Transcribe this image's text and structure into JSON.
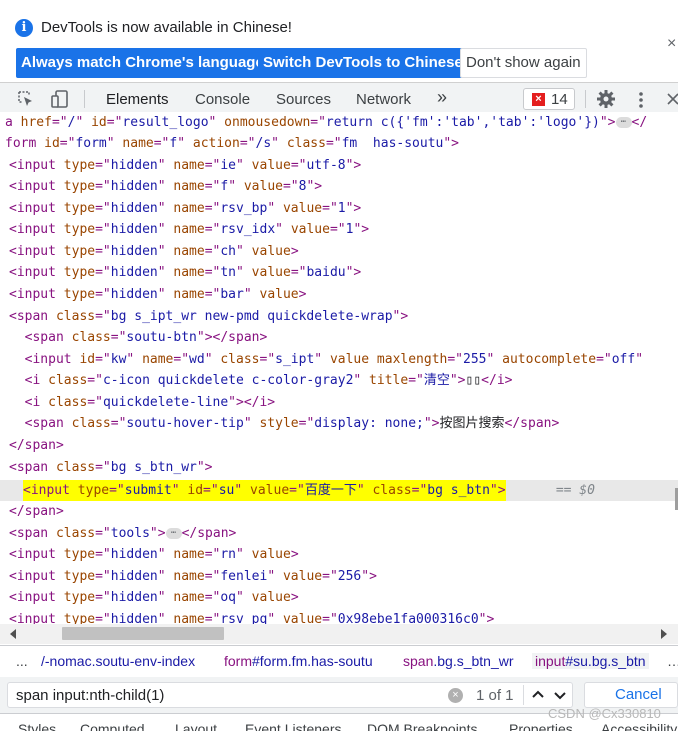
{
  "infobar": {
    "message": "DevTools is now available in Chinese!",
    "info_icon": "info-icon",
    "buttons": {
      "always_match": "Always match Chrome's language",
      "switch": "Switch DevTools to Chinese",
      "dont_show": "Don't show again"
    },
    "close": "×"
  },
  "toolbar": {
    "tabs": [
      "Elements",
      "Console",
      "Sources",
      "Network"
    ],
    "more": "»",
    "error_count": "14",
    "icons": [
      "inspect-element-icon",
      "device-toolbar-icon",
      "settings-gear-icon",
      "more-vertical-icon",
      "close-icon"
    ]
  },
  "code": {
    "lines": [
      [
        [
          "tg",
          "a "
        ],
        [
          "an",
          "href"
        ],
        [
          "tg",
          "=\""
        ],
        [
          "av",
          "/"
        ],
        [
          "tg",
          "\" "
        ],
        [
          "an",
          "id"
        ],
        [
          "tg",
          "=\""
        ],
        [
          "av",
          "result_logo"
        ],
        [
          "tg",
          "\" "
        ],
        [
          "an",
          "onmousedown"
        ],
        [
          "tg",
          "=\""
        ],
        [
          "av",
          "return c({'fm':'tab','tab':'logo'})"
        ],
        [
          "tg",
          "\">"
        ],
        [
          "ell",
          "⋯"
        ],
        [
          "tg",
          "</"
        ]
      ],
      [
        [
          "tg",
          "form "
        ],
        [
          "an",
          "id"
        ],
        [
          "tg",
          "=\""
        ],
        [
          "av",
          "form"
        ],
        [
          "tg",
          "\" "
        ],
        [
          "an",
          "name"
        ],
        [
          "tg",
          "=\""
        ],
        [
          "av",
          "f"
        ],
        [
          "tg",
          "\" "
        ],
        [
          "an",
          "action"
        ],
        [
          "tg",
          "=\""
        ],
        [
          "av",
          "/s"
        ],
        [
          "tg",
          "\" "
        ],
        [
          "an",
          "class"
        ],
        [
          "tg",
          "=\""
        ],
        [
          "av",
          "fm  has-soutu"
        ],
        [
          "tg",
          "\">"
        ]
      ],
      [
        [
          "tg",
          "<input "
        ],
        [
          "an",
          "type"
        ],
        [
          "tg",
          "=\""
        ],
        [
          "av",
          "hidden"
        ],
        [
          "tg",
          "\" "
        ],
        [
          "an",
          "name"
        ],
        [
          "tg",
          "=\""
        ],
        [
          "av",
          "ie"
        ],
        [
          "tg",
          "\" "
        ],
        [
          "an",
          "value"
        ],
        [
          "tg",
          "=\""
        ],
        [
          "av",
          "utf-8"
        ],
        [
          "tg",
          "\">"
        ]
      ],
      [
        [
          "tg",
          "<input "
        ],
        [
          "an",
          "type"
        ],
        [
          "tg",
          "=\""
        ],
        [
          "av",
          "hidden"
        ],
        [
          "tg",
          "\" "
        ],
        [
          "an",
          "name"
        ],
        [
          "tg",
          "=\""
        ],
        [
          "av",
          "f"
        ],
        [
          "tg",
          "\" "
        ],
        [
          "an",
          "value"
        ],
        [
          "tg",
          "=\""
        ],
        [
          "av",
          "8"
        ],
        [
          "tg",
          "\">"
        ]
      ],
      [
        [
          "tg",
          "<input "
        ],
        [
          "an",
          "type"
        ],
        [
          "tg",
          "=\""
        ],
        [
          "av",
          "hidden"
        ],
        [
          "tg",
          "\" "
        ],
        [
          "an",
          "name"
        ],
        [
          "tg",
          "=\""
        ],
        [
          "av",
          "rsv_bp"
        ],
        [
          "tg",
          "\" "
        ],
        [
          "an",
          "value"
        ],
        [
          "tg",
          "=\""
        ],
        [
          "av",
          "1"
        ],
        [
          "tg",
          "\">"
        ]
      ],
      [
        [
          "tg",
          "<input "
        ],
        [
          "an",
          "type"
        ],
        [
          "tg",
          "=\""
        ],
        [
          "av",
          "hidden"
        ],
        [
          "tg",
          "\" "
        ],
        [
          "an",
          "name"
        ],
        [
          "tg",
          "=\""
        ],
        [
          "av",
          "rsv_idx"
        ],
        [
          "tg",
          "\" "
        ],
        [
          "an",
          "value"
        ],
        [
          "tg",
          "=\""
        ],
        [
          "av",
          "1"
        ],
        [
          "tg",
          "\">"
        ]
      ],
      [
        [
          "tg",
          "<input "
        ],
        [
          "an",
          "type"
        ],
        [
          "tg",
          "=\""
        ],
        [
          "av",
          "hidden"
        ],
        [
          "tg",
          "\" "
        ],
        [
          "an",
          "name"
        ],
        [
          "tg",
          "=\""
        ],
        [
          "av",
          "ch"
        ],
        [
          "tg",
          "\" "
        ],
        [
          "an",
          "value"
        ],
        [
          "tg",
          ">"
        ]
      ],
      [
        [
          "tg",
          "<input "
        ],
        [
          "an",
          "type"
        ],
        [
          "tg",
          "=\""
        ],
        [
          "av",
          "hidden"
        ],
        [
          "tg",
          "\" "
        ],
        [
          "an",
          "name"
        ],
        [
          "tg",
          "=\""
        ],
        [
          "av",
          "tn"
        ],
        [
          "tg",
          "\" "
        ],
        [
          "an",
          "value"
        ],
        [
          "tg",
          "=\""
        ],
        [
          "av",
          "baidu"
        ],
        [
          "tg",
          "\">"
        ]
      ],
      [
        [
          "tg",
          "<input "
        ],
        [
          "an",
          "type"
        ],
        [
          "tg",
          "=\""
        ],
        [
          "av",
          "hidden"
        ],
        [
          "tg",
          "\" "
        ],
        [
          "an",
          "name"
        ],
        [
          "tg",
          "=\""
        ],
        [
          "av",
          "bar"
        ],
        [
          "tg",
          "\" "
        ],
        [
          "an",
          "value"
        ],
        [
          "tg",
          ">"
        ]
      ],
      [
        [
          "tg",
          "<span "
        ],
        [
          "an",
          "class"
        ],
        [
          "tg",
          "=\""
        ],
        [
          "av",
          "bg s_ipt_wr new-pmd quickdelete-wrap"
        ],
        [
          "tg",
          "\">"
        ]
      ],
      [
        [
          "tg",
          "  <span "
        ],
        [
          "an",
          "class"
        ],
        [
          "tg",
          "=\""
        ],
        [
          "av",
          "soutu-btn"
        ],
        [
          "tg",
          "\"></span>"
        ]
      ],
      [
        [
          "tg",
          "  <input "
        ],
        [
          "an",
          "id"
        ],
        [
          "tg",
          "=\""
        ],
        [
          "av",
          "kw"
        ],
        [
          "tg",
          "\" "
        ],
        [
          "an",
          "name"
        ],
        [
          "tg",
          "=\""
        ],
        [
          "av",
          "wd"
        ],
        [
          "tg",
          "\" "
        ],
        [
          "an",
          "class"
        ],
        [
          "tg",
          "=\""
        ],
        [
          "av",
          "s_ipt"
        ],
        [
          "tg",
          "\" "
        ],
        [
          "an",
          "value maxlength"
        ],
        [
          "tg",
          "=\""
        ],
        [
          "av",
          "255"
        ],
        [
          "tg",
          "\" "
        ],
        [
          "an",
          "autocomplete"
        ],
        [
          "tg",
          "=\""
        ],
        [
          "av",
          "off"
        ],
        [
          "tg",
          "\""
        ]
      ],
      [
        [
          "tg",
          "  <i "
        ],
        [
          "an",
          "class"
        ],
        [
          "tg",
          "=\""
        ],
        [
          "av",
          "c-icon quickdelete c-color-gray2"
        ],
        [
          "tg",
          "\" "
        ],
        [
          "an",
          "title"
        ],
        [
          "tg",
          "=\""
        ],
        [
          "av",
          "清空"
        ],
        [
          "tg",
          "\">"
        ],
        [
          "tx",
          "▯▯"
        ],
        [
          "tg",
          "</i>"
        ]
      ],
      [
        [
          "tg",
          "  <i "
        ],
        [
          "an",
          "class"
        ],
        [
          "tg",
          "=\""
        ],
        [
          "av",
          "quickdelete-line"
        ],
        [
          "tg",
          "\"></i>"
        ]
      ],
      [
        [
          "tg",
          "  <span "
        ],
        [
          "an",
          "class"
        ],
        [
          "tg",
          "=\""
        ],
        [
          "av",
          "soutu-hover-tip"
        ],
        [
          "tg",
          "\" "
        ],
        [
          "an",
          "style"
        ],
        [
          "tg",
          "=\""
        ],
        [
          "av",
          "display: none;"
        ],
        [
          "tg",
          "\">"
        ],
        [
          "tx",
          "按图片搜索"
        ],
        [
          "tg",
          "</span>"
        ]
      ],
      [
        [
          "tg",
          "</span>"
        ]
      ],
      [
        [
          "tg",
          "<span "
        ],
        [
          "an",
          "class"
        ],
        [
          "tg",
          "=\""
        ],
        [
          "av",
          "bg s_btn_wr"
        ],
        [
          "tg",
          "\">"
        ]
      ],
      [
        [
          "tg",
          "<input "
        ],
        [
          "an",
          "type"
        ],
        [
          "tg",
          "=\""
        ],
        [
          "av",
          "submit"
        ],
        [
          "tg",
          "\" "
        ],
        [
          "an",
          "id"
        ],
        [
          "tg",
          "=\""
        ],
        [
          "av",
          "su"
        ],
        [
          "tg",
          "\" "
        ],
        [
          "an",
          "value"
        ],
        [
          "tg",
          "=\""
        ],
        [
          "av",
          "百度一下"
        ],
        [
          "tg",
          "\" "
        ],
        [
          "an",
          "class"
        ],
        [
          "tg",
          "=\""
        ],
        [
          "av",
          "bg s_btn"
        ],
        [
          "tg",
          "\">"
        ]
      ],
      [
        [
          "tg",
          "</span>"
        ]
      ],
      [
        [
          "tg",
          "<span "
        ],
        [
          "an",
          "class"
        ],
        [
          "tg",
          "=\""
        ],
        [
          "av",
          "tools"
        ],
        [
          "tg",
          "\">"
        ],
        [
          "ell",
          "⋯"
        ],
        [
          "tg",
          "</span>"
        ]
      ],
      [
        [
          "tg",
          "<input "
        ],
        [
          "an",
          "type"
        ],
        [
          "tg",
          "=\""
        ],
        [
          "av",
          "hidden"
        ],
        [
          "tg",
          "\" "
        ],
        [
          "an",
          "name"
        ],
        [
          "tg",
          "=\""
        ],
        [
          "av",
          "rn"
        ],
        [
          "tg",
          "\" "
        ],
        [
          "an",
          "value"
        ],
        [
          "tg",
          ">"
        ]
      ],
      [
        [
          "tg",
          "<input "
        ],
        [
          "an",
          "type"
        ],
        [
          "tg",
          "=\""
        ],
        [
          "av",
          "hidden"
        ],
        [
          "tg",
          "\" "
        ],
        [
          "an",
          "name"
        ],
        [
          "tg",
          "=\""
        ],
        [
          "av",
          "fenlei"
        ],
        [
          "tg",
          "\" "
        ],
        [
          "an",
          "value"
        ],
        [
          "tg",
          "=\""
        ],
        [
          "av",
          "256"
        ],
        [
          "tg",
          "\">"
        ]
      ],
      [
        [
          "tg",
          "<input "
        ],
        [
          "an",
          "type"
        ],
        [
          "tg",
          "=\""
        ],
        [
          "av",
          "hidden"
        ],
        [
          "tg",
          "\" "
        ],
        [
          "an",
          "name"
        ],
        [
          "tg",
          "=\""
        ],
        [
          "av",
          "oq"
        ],
        [
          "tg",
          "\" "
        ],
        [
          "an",
          "value"
        ],
        [
          "tg",
          ">"
        ]
      ],
      [
        [
          "tg",
          "<input "
        ],
        [
          "an",
          "type"
        ],
        [
          "tg",
          "=\""
        ],
        [
          "av",
          "hidden"
        ],
        [
          "tg",
          "\" "
        ],
        [
          "an",
          "name"
        ],
        [
          "tg",
          "=\""
        ],
        [
          "av",
          "rsv_pq"
        ],
        [
          "tg",
          "\" "
        ],
        [
          "an",
          "value"
        ],
        [
          "tg",
          "=\""
        ],
        [
          "av",
          "0x98ebe1fa000316c0"
        ],
        [
          "tg",
          "\">"
        ]
      ]
    ],
    "selected_suffix": " == $0"
  },
  "breadcrumbs": {
    "more": "...",
    "items": [
      {
        "tag": "",
        "cls": "/-nomac.soutu-env-index"
      },
      {
        "tag": "form",
        "cls": "#form.fm.has-soutu"
      },
      {
        "tag": "span",
        "cls": ".bg.s_btn_wr"
      },
      {
        "tag": "input",
        "cls": "#su.bg.s_btn"
      }
    ],
    "overflow": "…"
  },
  "search": {
    "query": "span input:nth-child(1)",
    "clear": "×",
    "count": "1 of 1",
    "cancel": "Cancel"
  },
  "bottom_tabs": [
    "Styles",
    "Computed",
    "Layout",
    "Event Listeners",
    "DOM Breakpoints",
    "Properties",
    "Accessibility"
  ],
  "watermark": "CSDN @Cx330810"
}
